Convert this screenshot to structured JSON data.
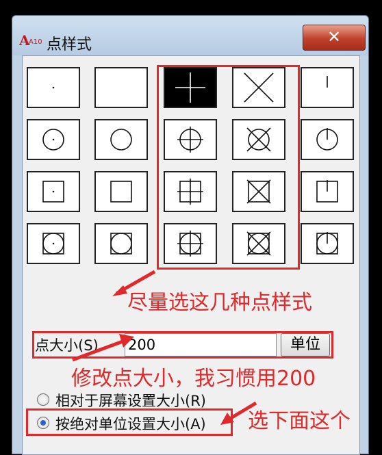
{
  "window": {
    "title": "点样式",
    "close_label": "✕",
    "icon": "autocad-icon",
    "icon_text": "A10"
  },
  "point_styles": [
    [
      "dot",
      "blank",
      "plus",
      "x",
      "tick"
    ],
    [
      "circle-dot",
      "circle",
      "circle-plus",
      "circle-x",
      "circle-tick"
    ],
    [
      "square-dot",
      "square",
      "square-plus",
      "square-x",
      "square-tick"
    ],
    [
      "square-circle-dot",
      "square-circle",
      "square-circle-plus",
      "square-circle-x",
      "square-circle-tick"
    ]
  ],
  "selected_style": "plus",
  "point_size": {
    "label": "点大小(S)",
    "value": "200",
    "unit_button": "单位"
  },
  "radio_options": [
    {
      "label": "相对于屏幕设置大小(R)",
      "selected": false
    },
    {
      "label": "按绝对单位设置大小(A)",
      "selected": true
    }
  ],
  "annotations": {
    "styles_note": "尽量选这几种点样式",
    "size_note": "修改点大小，我习惯用200",
    "radio_note": "选下面这个"
  },
  "colors": {
    "annotation": "#e0292a",
    "title_bar": "#c8d9ee",
    "close_button": "#c0412b"
  }
}
